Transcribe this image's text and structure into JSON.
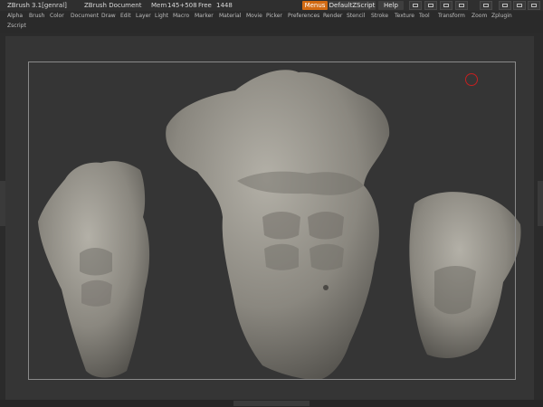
{
  "titlebar": {
    "app": "ZBrush",
    "version": "3.1[genral]",
    "document": "ZBrush Document",
    "mem": "Mem",
    "mem_value": "145+508",
    "free": "Free",
    "free_value": "1448",
    "menus_label": "Menus",
    "script_label": "DefaultZScript",
    "help_label": "Help"
  },
  "menus": [
    "Alpha",
    "Brush",
    "Color",
    "Document",
    "Draw",
    "Edit",
    "Layer",
    "Light",
    "Macro",
    "Marker",
    "Material",
    "Movie",
    "Picker",
    "Preferences",
    "Render",
    "Stencil",
    "Stroke",
    "Texture",
    "Tool",
    "Transform",
    "Zoom",
    "Zplugin",
    "Zscript"
  ],
  "colors": {
    "accent": "#d26a12",
    "cursor": "#c42020",
    "background": "#2b2b2b",
    "canvas": "#353535",
    "model": "#8a877f"
  }
}
